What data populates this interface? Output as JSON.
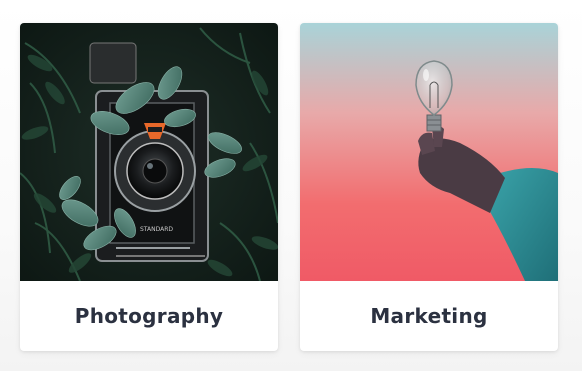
{
  "cards": [
    {
      "title": "Photography",
      "image_subject": "camera-among-leaves",
      "colors": {
        "label_text": "#2b3140",
        "dominant": "#1f3028",
        "accent": "#e8682a"
      }
    },
    {
      "title": "Marketing",
      "image_subject": "hand-holding-lightbulb",
      "colors": {
        "label_text": "#2b3140",
        "sky_top": "#a9d3d8",
        "sky_bottom": "#f0606a",
        "sleeve": "#2c8c95"
      }
    }
  ]
}
